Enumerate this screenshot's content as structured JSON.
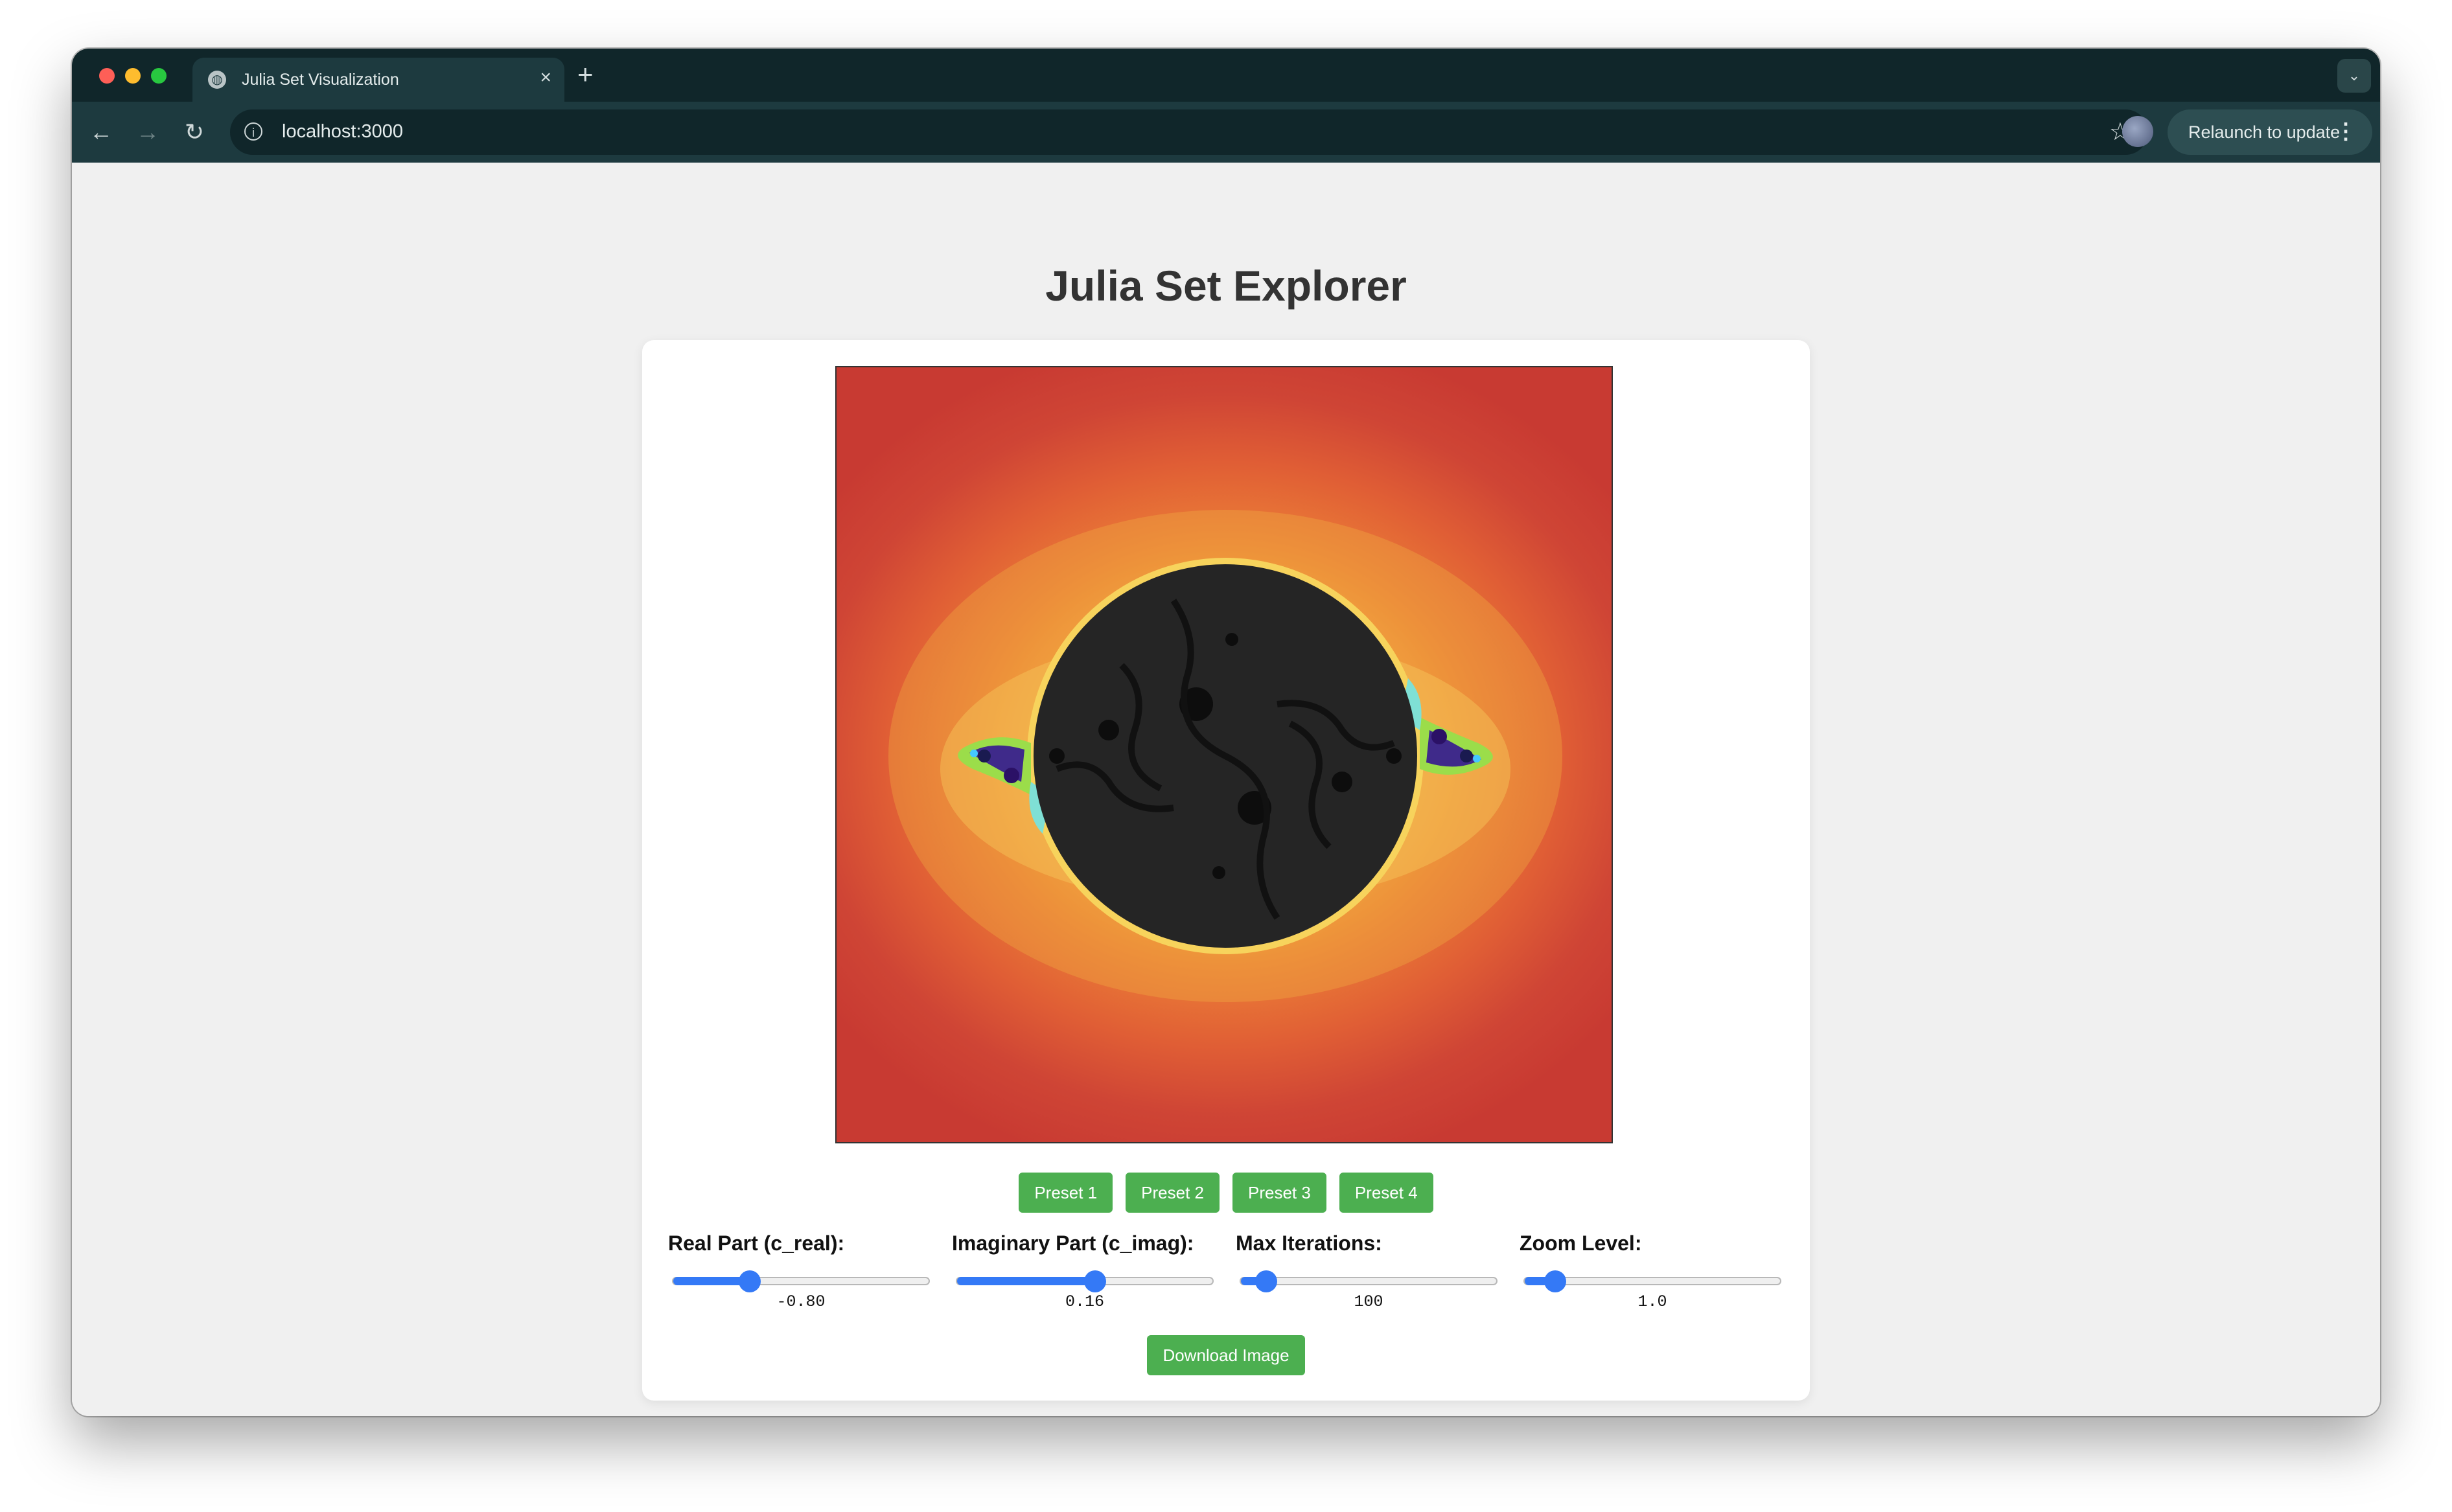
{
  "browser": {
    "tab_title": "Julia Set Visualization",
    "new_tab_label": "+",
    "tab_close_label": "×",
    "url": "localhost:3000",
    "relaunch_label": "Relaunch to update"
  },
  "page": {
    "title": "Julia Set Explorer",
    "presets": [
      "Preset 1",
      "Preset 2",
      "Preset 3",
      "Preset 4"
    ],
    "download_label": "Download Image"
  },
  "controls": [
    {
      "label": "Real Part (c_real):",
      "value": "-0.80",
      "fraction": 0.3
    },
    {
      "label": "Imaginary Part (c_imag):",
      "value": "0.16",
      "fraction": 0.54
    },
    {
      "label": "Max Iterations:",
      "value": "100",
      "fraction": 0.1
    },
    {
      "label": "Zoom Level:",
      "value": "1.0",
      "fraction": 0.12
    }
  ],
  "colors": {
    "accent_green": "#4caf50",
    "slider_blue": "#3479f6",
    "fractal_background": "#c83a32",
    "fractal_interior": "#252525"
  }
}
